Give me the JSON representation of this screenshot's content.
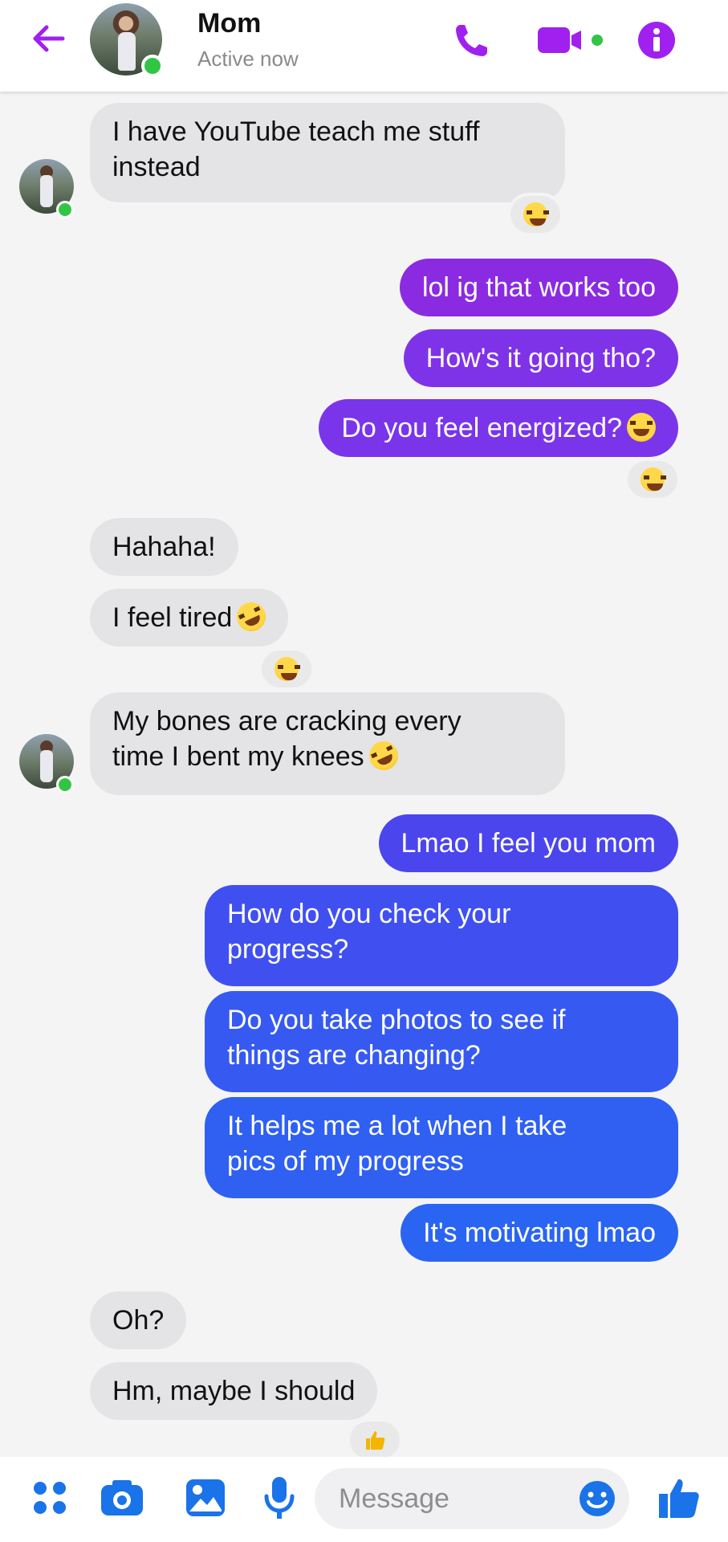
{
  "header": {
    "contact_name": "Mom",
    "status": "Active now",
    "accent_color": "#a020f0"
  },
  "messages": [
    {
      "text": "I have YouTube teach me stuff",
      "text2": "instead",
      "from": "them",
      "reaction": "laughing-emoji"
    },
    {
      "text": "lol ig that works too",
      "from": "me"
    },
    {
      "text": "How's it going tho?",
      "from": "me"
    },
    {
      "text": "Do you feel energized?",
      "from": "me",
      "emoji": "joy-emoji",
      "reaction": "laughing-emoji"
    },
    {
      "text": "Hahaha!",
      "from": "them"
    },
    {
      "text": "I feel tired",
      "from": "them",
      "emoji": "rofl-emoji",
      "reaction": "laughing-emoji"
    },
    {
      "text": "My bones are cracking every",
      "text2": "time I bent my knees",
      "from": "them",
      "emoji": "rofl-emoji"
    },
    {
      "text": "Lmao I feel you mom",
      "from": "me"
    },
    {
      "text": "How do you check your",
      "text2": "progress?",
      "from": "me"
    },
    {
      "text": "Do you take photos to see if",
      "text2": "things are changing?",
      "from": "me"
    },
    {
      "text": "It helps me a lot when I take",
      "text2": "pics of my progress",
      "from": "me"
    },
    {
      "text": "It's motivating lmao",
      "from": "me"
    },
    {
      "text": "Oh?",
      "from": "them"
    },
    {
      "text": "Hm, maybe I should",
      "from": "them",
      "reaction": "thumbs-up-emoji"
    }
  ],
  "composer": {
    "placeholder": "Message"
  },
  "colors": {
    "outgoing_top": "#8a2be2",
    "outgoing_bottom": "#2a64f2",
    "incoming": "#e4e4e6",
    "toolbar_blue": "#1a73e8",
    "online": "#31c545"
  }
}
